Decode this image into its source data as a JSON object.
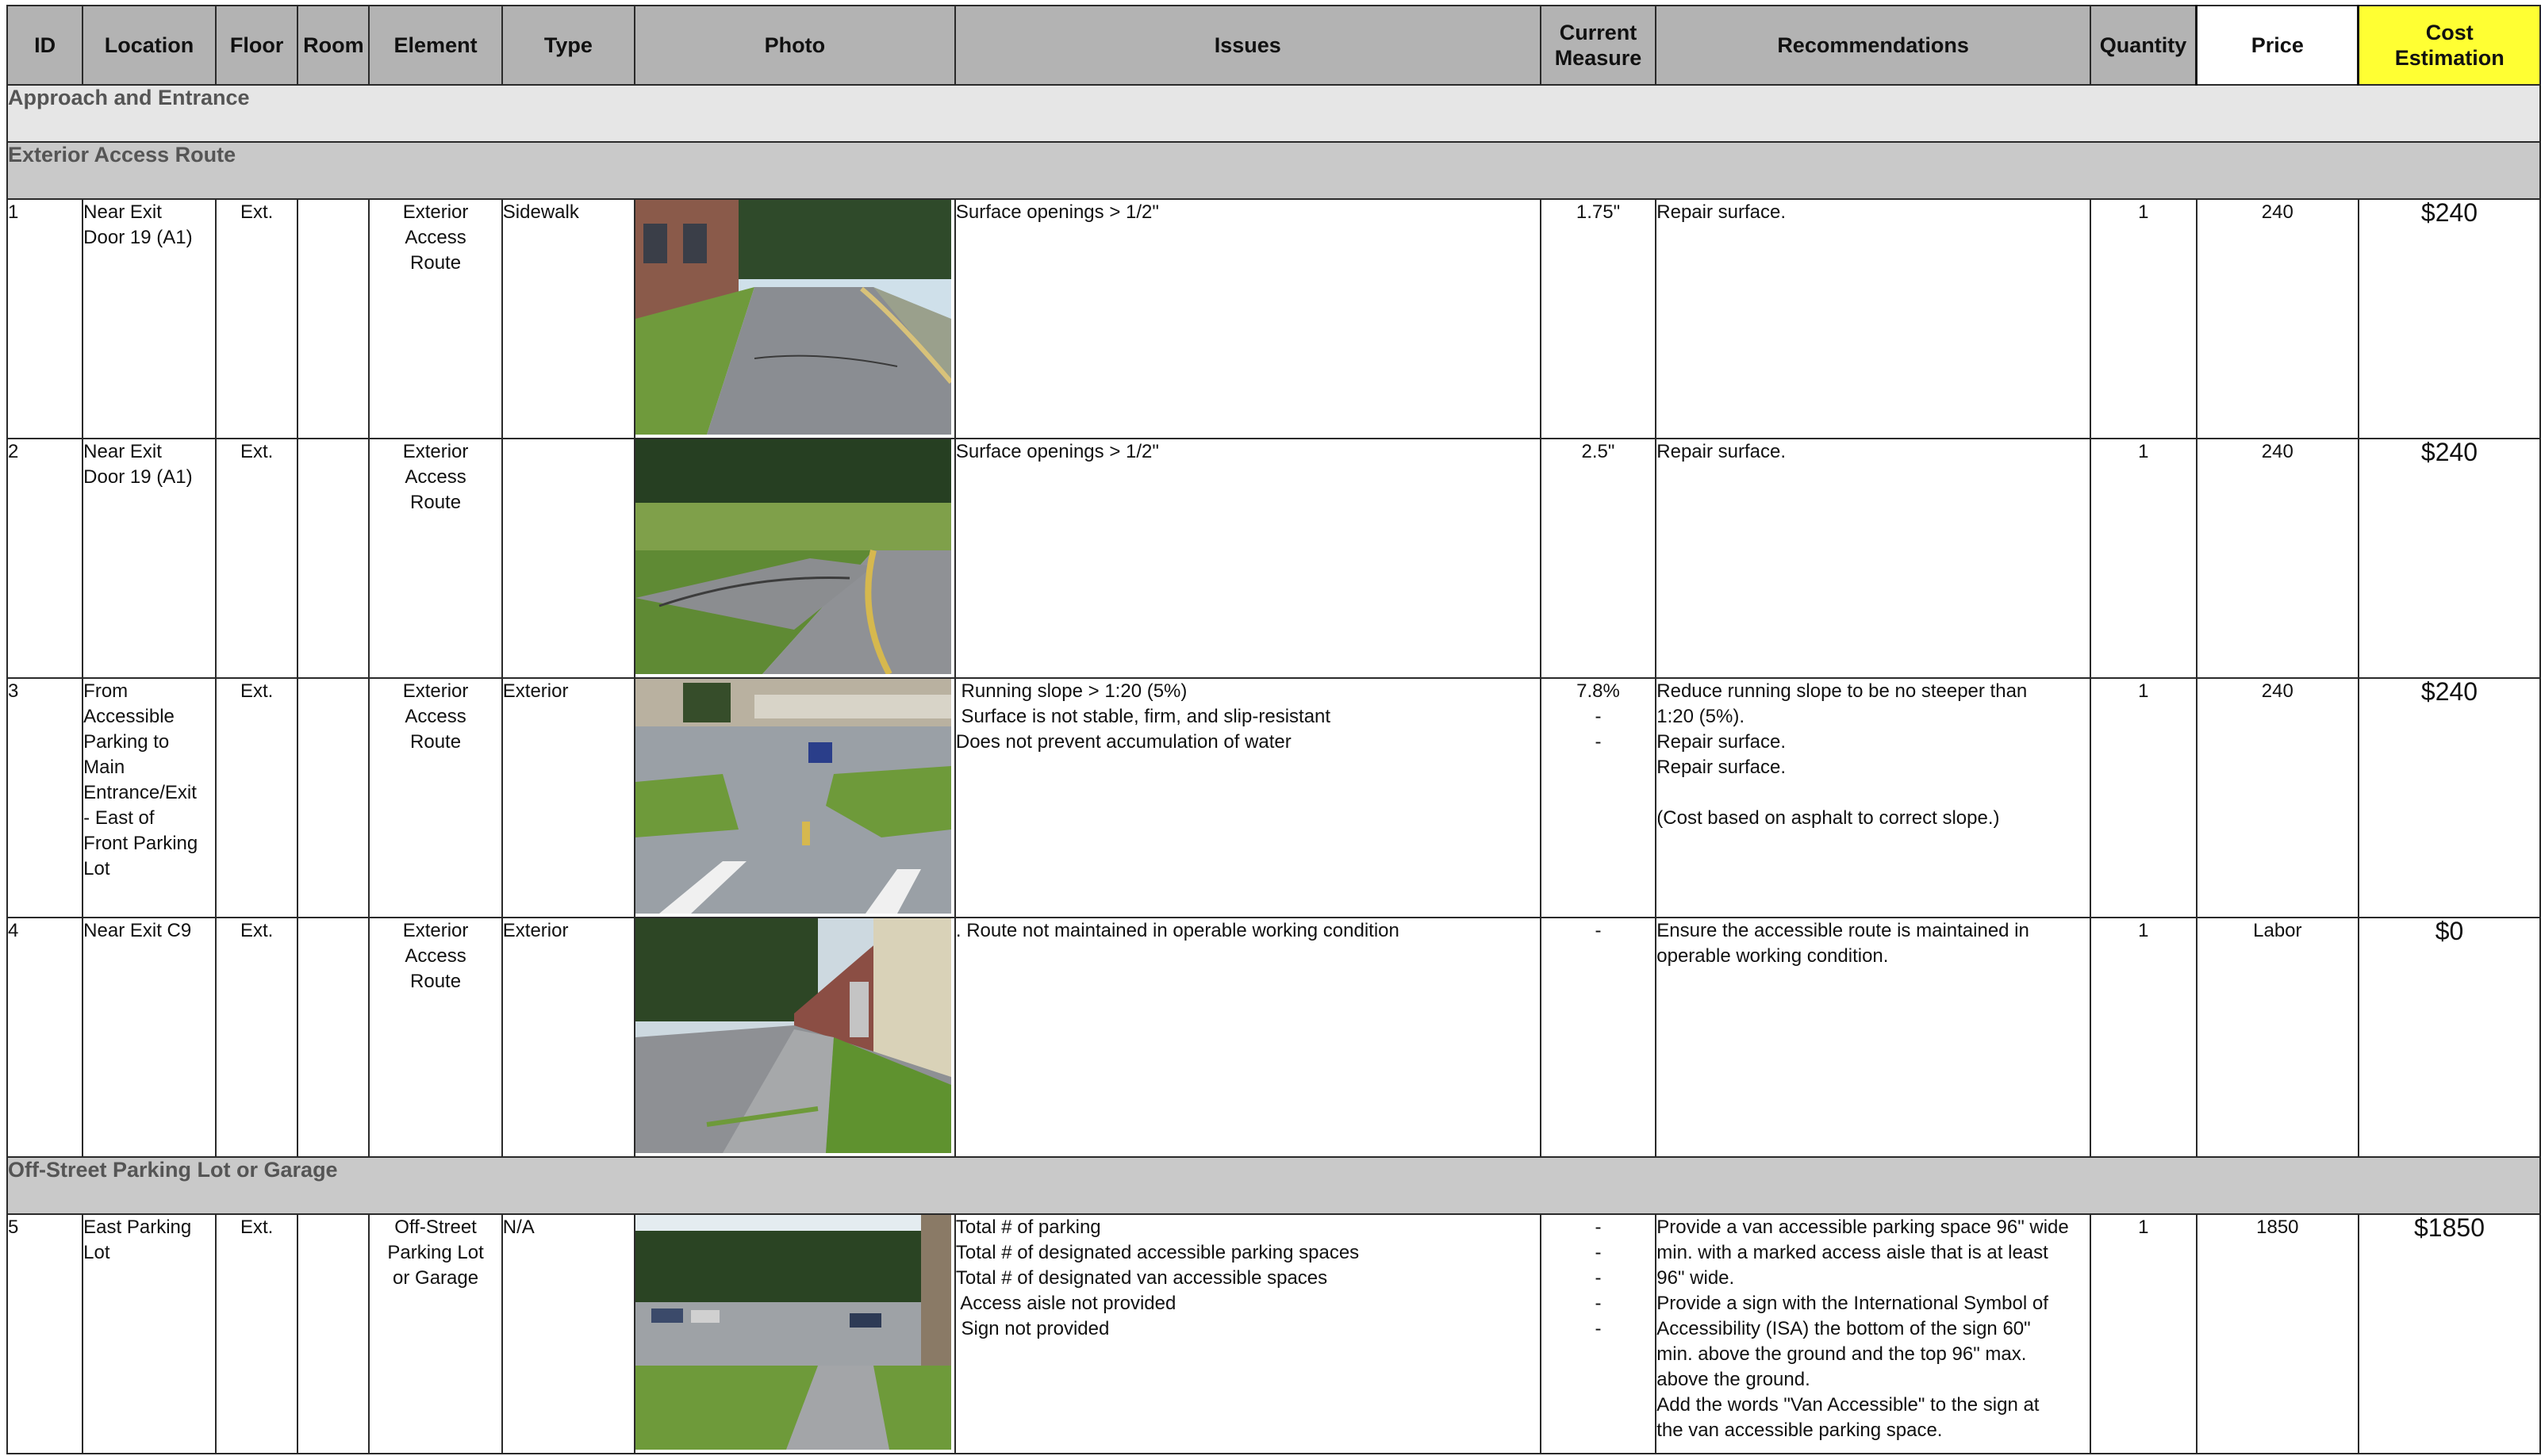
{
  "headers": {
    "id": "ID",
    "location": "Location",
    "floor": "Floor",
    "room": "Room",
    "element": "Element",
    "type": "Type",
    "photo": "Photo",
    "issues": "Issues",
    "current_measure_1": "Current",
    "current_measure_2": "Measure",
    "recommendations": "Recommendations",
    "quantity": "Quantity",
    "price": "Price",
    "cost_1": "Cost",
    "cost_2": "Estimation"
  },
  "colors": {
    "header_bg": "#b3b3b3",
    "cost_header_bg": "#ffff33",
    "group_bg": "#e6e6e6",
    "subgroup_bg": "#c9c9c9"
  },
  "sections": {
    "approach": "Approach and Entrance",
    "exterior_route": "Exterior Access Route",
    "parking": "Off-Street Parking Lot or Garage"
  },
  "rows": [
    {
      "id": "1",
      "location": "Near Exit\nDoor 19 (A1)",
      "floor": "Ext.",
      "room": "",
      "element": "Exterior\nAccess\nRoute",
      "type": "Sidewalk",
      "photo_icon": "photo-sidewalk-building",
      "issues": "Surface openings > 1/2\"",
      "measure": "1.75\"",
      "recommendations": "Repair surface.",
      "quantity": "1",
      "price": "240",
      "cost": "$240"
    },
    {
      "id": "2",
      "location": "Near Exit\nDoor 19 (A1)",
      "floor": "Ext.",
      "room": "",
      "element": "Exterior\nAccess\nRoute",
      "type": "",
      "photo_icon": "photo-curb-path",
      "issues": "Surface openings > 1/2\"",
      "measure": "2.5\"",
      "recommendations": "Repair surface.",
      "quantity": "1",
      "price": "240",
      "cost": "$240"
    },
    {
      "id": "3",
      "location": "From\nAccessible\nParking to\nMain\nEntrance/Exit\n- East of\nFront Parking\nLot",
      "floor": "Ext.",
      "room": "",
      "element": "Exterior\nAccess\nRoute",
      "type": "Exterior",
      "photo_icon": "photo-parking-entrance",
      "issues": " Running slope > 1:20 (5%)\n Surface is not stable, firm, and slip-resistant\nDoes not prevent accumulation of water",
      "measure": "7.8%\n-\n-",
      "recommendations": "Reduce running slope to be no steeper than\n1:20 (5%).\nRepair surface.\nRepair surface.\n\n(Cost based on asphalt to correct slope.)",
      "quantity": "1",
      "price": "240",
      "cost": "$240"
    },
    {
      "id": "4",
      "location": "Near Exit C9",
      "floor": "Ext.",
      "room": "",
      "element": "Exterior\nAccess\nRoute",
      "type": "Exterior",
      "photo_icon": "photo-route-brick-building",
      "issues": ". Route not maintained in operable working condition",
      "measure": "-",
      "recommendations": "Ensure the accessible route is maintained in\noperable working condition.",
      "quantity": "1",
      "price": "Labor",
      "cost": "$0"
    }
  ],
  "parking_row": {
    "id": "5",
    "location": "East Parking\nLot",
    "floor": "Ext.",
    "room": "",
    "element": "Off-Street\nParking Lot\nor Garage",
    "type": "N/A",
    "photo_icon": "photo-east-parking-lot",
    "issues": "Total # of parking\nTotal # of designated accessible parking spaces\nTotal # of designated van accessible spaces\n Access aisle not provided\n Sign not provided",
    "measure": "-\n-\n-\n-\n-",
    "recommendations": "Provide a van accessible parking space 96\" wide\nmin. with a marked access aisle that is at least\n96\" wide.\nProvide a sign with the International Symbol of\nAccessibility (ISA) the bottom of the sign 60\"\nmin. above the ground and the top 96\" max.\nabove the ground.\nAdd the words \"Van Accessible\" to the sign at\nthe van accessible parking space.",
    "quantity": "1",
    "price": "1850",
    "cost": "$1850"
  }
}
